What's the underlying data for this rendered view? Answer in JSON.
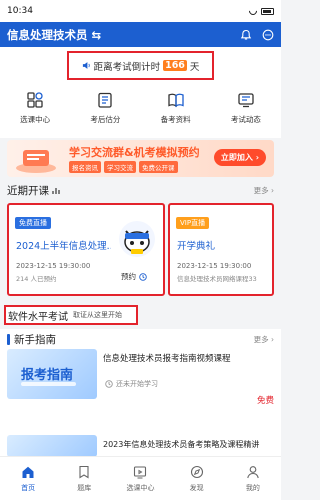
{
  "status_bar": {
    "time": "10:34"
  },
  "app_bar": {
    "title": "信息处理技术员",
    "switch_glyph": "⇆"
  },
  "countdown": {
    "prefix": "距离考试倒计时",
    "days": "166",
    "suffix": "天"
  },
  "quick_links": [
    {
      "label": "选课中心",
      "icon": "grid-apps-icon"
    },
    {
      "label": "考后估分",
      "icon": "clipboard-icon"
    },
    {
      "label": "备考资料",
      "icon": "book-icon"
    },
    {
      "label": "考试动态",
      "icon": "news-icon"
    }
  ],
  "banner": {
    "title": "学习交流群&机考模拟预约",
    "tags": [
      "报名资讯",
      "学习交流",
      "免费公开课"
    ],
    "button": "立即加入 ›"
  },
  "recent_live": {
    "title": "近期开课",
    "more": "更多 ›",
    "cards": [
      {
        "badge": "免费直播",
        "title": "2024上半年信息处理...",
        "time": "2023-12-15 19:30:00",
        "sub": "214 人已预约",
        "action": "预约"
      },
      {
        "badge": "VIP直播",
        "title": "开学典礼",
        "time": "2023-12-15 19:30:00",
        "sub": "信息处理技术员网络课程33"
      }
    ]
  },
  "exam": {
    "title": "软件水平考试",
    "subtitle": "取证从这里开始"
  },
  "guide": {
    "title": "新手指南",
    "more": "更多 ›",
    "items": [
      {
        "thumb_text": "报考指南",
        "title": "信息处理技术员报考指南视频课程",
        "sub": "还未开始学习"
      },
      {
        "thumb_text": "",
        "title": "2023年信息处理技术员备考策略及课程精讲",
        "price": "免费"
      }
    ]
  },
  "tabs": [
    {
      "label": "首页",
      "icon": "home-icon",
      "active": true
    },
    {
      "label": "题库",
      "icon": "bookmark-icon",
      "active": false
    },
    {
      "label": "选课中心",
      "icon": "course-icon",
      "active": false
    },
    {
      "label": "发现",
      "icon": "compass-icon",
      "active": false
    },
    {
      "label": "我的",
      "icon": "user-icon",
      "active": false
    }
  ],
  "colors": {
    "primary": "#1c5fd0",
    "highlight_border": "#e3232c",
    "accent_orange": "#ff7e1d"
  }
}
